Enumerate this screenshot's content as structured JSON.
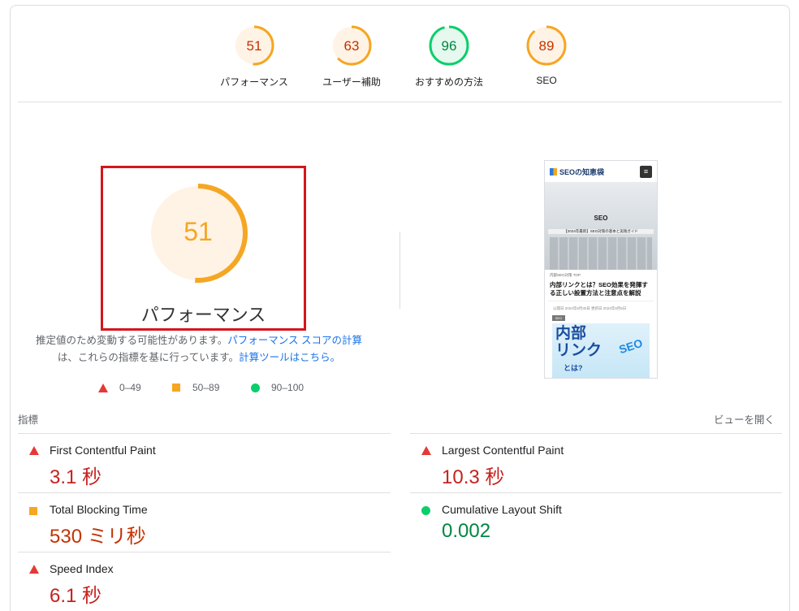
{
  "categories": [
    {
      "label": "パフォーマンス",
      "score": "51",
      "value": 51,
      "rating": "average"
    },
    {
      "label": "ユーザー補助",
      "score": "63",
      "value": 63,
      "rating": "average"
    },
    {
      "label": "おすすめの方法",
      "score": "96",
      "value": 96,
      "rating": "pass"
    },
    {
      "label": "SEO",
      "score": "89",
      "value": 89,
      "rating": "average"
    }
  ],
  "main": {
    "score": "51",
    "value": 51,
    "label": "パフォーマンス",
    "note_text_1": "推定値のため変動する可能性があります。",
    "note_link_1": "パフォーマンス スコアの計算",
    "note_text_2": "は、これらの指標を基に行っています。",
    "note_link_2": "計算ツールはこちら。"
  },
  "legend": [
    {
      "range": "0–49",
      "icon": "triangle-icon",
      "color": "#e53935"
    },
    {
      "range": "50–89",
      "icon": "square-icon",
      "color": "#f5a623"
    },
    {
      "range": "90–100",
      "icon": "circle-icon",
      "color": "#0cce6b"
    }
  ],
  "preview": {
    "site_name": "SEOの知恵袋",
    "hero_title": "SEO",
    "hero_subtitle": "【2024年最新】SEO対策の基本と実践ガイド",
    "category": "内部SEO対策 TOP",
    "article_title": "内部リンクとは？SEO効果を発揮する正しい設置方法と注意点を解説",
    "meta": "公開日 2024年8月30日 更新日 2024年9月5日",
    "tag": "SEO",
    "thumb_big": "内部\nリンク",
    "thumb_small": "とは?",
    "thumb_seo": "SEO"
  },
  "metrics": {
    "header": "指標",
    "view_toggle": "ビューを開く",
    "items": [
      {
        "name": "First Contentful Paint",
        "value": "3.1 秒",
        "rating": "fail"
      },
      {
        "name": "Largest Contentful Paint",
        "value": "10.3 秒",
        "rating": "fail"
      },
      {
        "name": "Total Blocking Time",
        "value": "530 ミリ秒",
        "rating": "average"
      },
      {
        "name": "Cumulative Layout Shift",
        "value": "0.002",
        "rating": "pass"
      },
      {
        "name": "Speed Index",
        "value": "6.1 秒",
        "rating": "fail"
      }
    ]
  },
  "colors": {
    "fail": "#e53935",
    "average": "#f5a623",
    "pass": "#0cce6b",
    "average_bg": "#fff3e6",
    "pass_bg": "#e6f9ee",
    "highlight": "#d4161c"
  }
}
